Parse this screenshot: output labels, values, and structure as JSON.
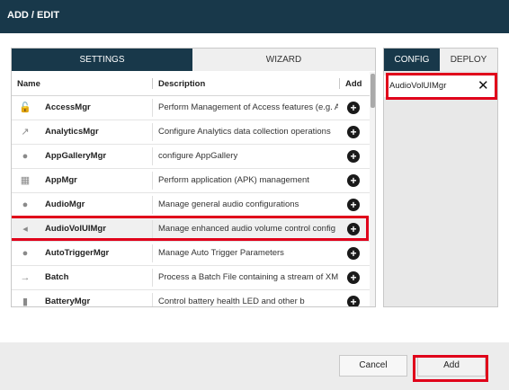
{
  "window": {
    "title": "ADD / EDIT"
  },
  "left_tabs": {
    "settings": "SETTINGS",
    "wizard": "WIZARD"
  },
  "table": {
    "headers": {
      "name": "Name",
      "description": "Description",
      "add": "Add"
    },
    "rows": [
      {
        "icon": "lock-icon",
        "name": "AccessMgr",
        "description": "Perform Management of Access features (e.g. A"
      },
      {
        "icon": "chart-icon",
        "name": "AnalyticsMgr",
        "description": "Configure Analytics data collection operations"
      },
      {
        "icon": "app-gallery-icon",
        "name": "AppGalleryMgr",
        "description": "configure AppGallery"
      },
      {
        "icon": "grid-icon",
        "name": "AppMgr",
        "description": "Perform application (APK) management"
      },
      {
        "icon": "audio-badge-icon",
        "name": "AudioMgr",
        "description": "Manage general audio configurations"
      },
      {
        "icon": "speaker-icon",
        "name": "AudioVolUIMgr",
        "description": "Manage enhanced audio volume control config"
      },
      {
        "icon": "trigger-badge-icon",
        "name": "AutoTriggerMgr",
        "description": "Manage Auto Trigger Parameters"
      },
      {
        "icon": "batch-icon",
        "name": "Batch",
        "description": "Process a Batch File containing a stream of XML"
      },
      {
        "icon": "battery-icon",
        "name": "BatteryMgr",
        "description": "Control battery health LED and other b"
      }
    ]
  },
  "right_tabs": {
    "config": "CONFIG",
    "deploy": "DEPLOY"
  },
  "config_items": [
    {
      "name": "AudioVolUIMgr"
    }
  ],
  "footer": {
    "cancel": "Cancel",
    "add": "Add"
  }
}
